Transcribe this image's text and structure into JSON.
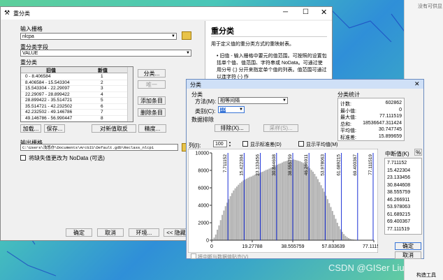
{
  "bg_corner_text": "没有可供显",
  "reclass": {
    "title": "重分类",
    "input_raster_label": "输入栅格",
    "input_raster_value": "nlcpa",
    "field_label": "重分类字段",
    "field_value": "VALUE",
    "reclass_label": "重分类",
    "table_headers": [
      "旧值",
      "新值"
    ],
    "rows": [
      {
        "old": "0 - 8.406584",
        "new": "1"
      },
      {
        "old": "8.406584 - 15.543304",
        "new": "2"
      },
      {
        "old": "15.543304 - 22.29097",
        "new": "3"
      },
      {
        "old": "22.29097 - 28.899422",
        "new": "4"
      },
      {
        "old": "28.899422 - 35.514721",
        "new": "5"
      },
      {
        "old": "35.514721 - 42.232502",
        "new": "6"
      },
      {
        "old": "42.232502 - 49.146786",
        "new": "7"
      },
      {
        "old": "49.146786 - 56.990447",
        "new": "8"
      }
    ],
    "buttons": {
      "classify": "分类...",
      "unique": "唯一",
      "add": "添加条目",
      "delete": "删除条目",
      "load": "加载...",
      "save": "保存...",
      "reverse": "对新值取反",
      "precision": "精度..."
    },
    "output_label": "输出栅格",
    "output_value": "C:\\Users\\浅悠亦\\Documents\\ArcGIS\\Default.gdb\\Reclass_nlcp1",
    "nodata_label": "将缺失值更改为 NoData (可选)",
    "bottom_buttons": {
      "ok": "确定",
      "cancel": "取消",
      "env": "环境...",
      "hide": "<< 隐藏帮"
    }
  },
  "help": {
    "title": "重分类",
    "desc": "用于定义值的重分类方式的重映射表。",
    "bullet": "旧值 - 输入栅格中要元的值范围。可按照的设置包括单个值、值范围、字符串或 NoData。可通过使用分号 (;) 分开来指定单个值的列表。值范围可通过以连字符 (-) 作"
  },
  "classify": {
    "title": "分类",
    "group_label": "分类",
    "method_label": "方法(M):",
    "method_value": "相等间隔",
    "classes_label": "类别(C):",
    "classes_value": "10",
    "exclusion_label": "数据排除",
    "exclude_btn": "排除(X)...",
    "sample_btn": "采样(S)...",
    "columns_label": "列(I):",
    "columns_value": "100",
    "show_std": "显示标准差(D)",
    "show_mean": "显示平均值(M)",
    "snap_label": "将中断与数据值贴齐(V)",
    "ok": "确定",
    "cancel": "取消",
    "stats_label": "分类统计",
    "stats": [
      {
        "k": "计数:",
        "v": "602862"
      },
      {
        "k": "最小值:",
        "v": "0"
      },
      {
        "k": "最大值:",
        "v": "77.111519"
      },
      {
        "k": "总和:",
        "v": "18536647.311424"
      },
      {
        "k": "平均值:",
        "v": "30.747745"
      },
      {
        "k": "标准差:",
        "v": "15.899659"
      }
    ],
    "breaks_label": "中断值(K)",
    "pct_label": "%",
    "breaks": [
      "7.711152",
      "15.422304",
      "23.133456",
      "30.844608",
      "38.555759",
      "46.266911",
      "53.978063",
      "61.689215",
      "69.400367",
      "77.111519"
    ],
    "yticks": [
      "10000",
      "8000",
      "6000",
      "4000",
      "2000",
      "0"
    ],
    "xticks": [
      "0",
      "19.27788",
      "38.555759",
      "57.833639",
      "77.111519"
    ]
  },
  "watermark": "CSDN @GISer Liu",
  "bottom_right_text": "构造工具",
  "chart_data": {
    "type": "bar",
    "title": "",
    "xlabel": "",
    "ylabel": "",
    "xlim": [
      0,
      77.111519
    ],
    "ylim": [
      0,
      10000
    ],
    "bins": 100,
    "breaks": [
      7.711152,
      15.422304,
      23.133456,
      30.844608,
      38.555759,
      46.266911,
      53.978063,
      61.689215,
      69.400367,
      77.111519
    ],
    "values": [
      80,
      300,
      650,
      1200,
      1700,
      2300,
      2900,
      3400,
      3900,
      4300,
      4700,
      5050,
      5400,
      5700,
      5950,
      6150,
      6350,
      6550,
      6700,
      6850,
      6950,
      7050,
      7150,
      7250,
      7300,
      7400,
      7500,
      7550,
      7650,
      7700,
      7800,
      7850,
      7950,
      8050,
      8100,
      8200,
      8300,
      8400,
      8450,
      8550,
      8650,
      8750,
      8800,
      8900,
      9000,
      9050,
      9100,
      9150,
      9200,
      9200,
      9250,
      9200,
      9150,
      9100,
      9050,
      8950,
      8850,
      8750,
      8600,
      8450,
      8250,
      8050,
      7850,
      7600,
      7300,
      7000,
      6650,
      6300,
      5950,
      5550,
      5100,
      4700,
      4250,
      3800,
      3350,
      2900,
      2450,
      2000,
      1600,
      1250,
      950,
      700,
      500,
      350,
      240,
      160,
      110,
      80,
      60,
      45,
      35,
      25,
      20,
      15,
      12,
      10,
      8,
      6,
      5,
      4
    ]
  }
}
